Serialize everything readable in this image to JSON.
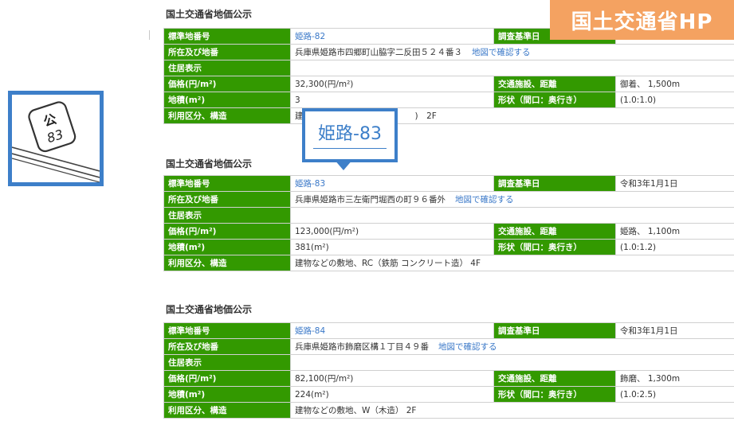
{
  "banner": {
    "label": "国土交通省HP"
  },
  "sign": {
    "top": "公",
    "number": "83"
  },
  "callout": {
    "label": "姫路-83"
  },
  "field_labels": {
    "id": "標準地番号",
    "address": "所在及び地番",
    "residential": "住居表示",
    "price": "価格(円/m²)",
    "area": "地積(m²)",
    "usage": "利用区分、構造",
    "survey_date": "調査基準日",
    "transport": "交通施設、距離",
    "shape": "形状（間口：奥行き）"
  },
  "map_link_label": "地図で確認する",
  "records": [
    {
      "title": "国土交通省地価公示",
      "id": "姫路-82",
      "address": "兵庫県姫路市四郷町山脇字二反田５２４番３",
      "residential": "",
      "price": "32,300(円/m²)",
      "area": "3",
      "usage": "建",
      "usage_tail": ")　2F",
      "survey_date": "",
      "transport": "御着、 1,500m",
      "shape": "(1.0:1.0)"
    },
    {
      "title": "国土交通省地価公示",
      "id": "姫路-83",
      "address": "兵庫県姫路市三左衛門堀西の町９６番外",
      "residential": "",
      "price": "123,000(円/m²)",
      "area": "381(m²)",
      "usage": "建物などの敷地、RC（鉄筋 コンクリート造） 4F",
      "usage_tail": "",
      "survey_date": "令和3年1月1日",
      "transport": "姫路、 1,100m",
      "shape": "(1.0:1.2)"
    },
    {
      "title": "国土交通省地価公示",
      "id": "姫路-84",
      "address": "兵庫県姫路市飾磨区構１丁目４９番",
      "residential": "",
      "price": "82,100(円/m²)",
      "area": "224(m²)",
      "usage": "建物などの敷地、W（木造） 2F",
      "usage_tail": "",
      "survey_date": "令和3年1月1日",
      "transport": "飾磨、 1,300m",
      "shape": "(1.0:2.5)"
    }
  ]
}
